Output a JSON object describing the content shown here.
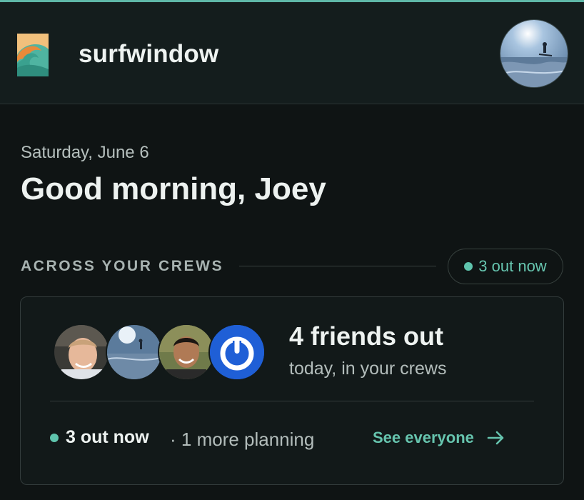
{
  "header": {
    "app_name": "surfwindow",
    "logo_icon": "wave-logo-icon",
    "profile_icon": "profile-avatar"
  },
  "greeting": {
    "date": "Saturday, June 6",
    "title": "Good morning, Joey"
  },
  "crews_section": {
    "label": "ACROSS YOUR CREWS",
    "status_pill": "3 out now"
  },
  "crew_card": {
    "friends_count": "4 friends out",
    "subtitle": "today, in your crews",
    "avatars": [
      "friend-avatar",
      "surfer-avatar",
      "friend-avatar",
      "power-logo-avatar"
    ],
    "out_now": "3 out now",
    "planning": "· 1 more planning",
    "see_everyone": "See everyone"
  },
  "colors": {
    "accent": "#5fc4ad",
    "background": "#0f1414",
    "header": "#141d1d",
    "blue_avatar": "#1f5fd6"
  }
}
